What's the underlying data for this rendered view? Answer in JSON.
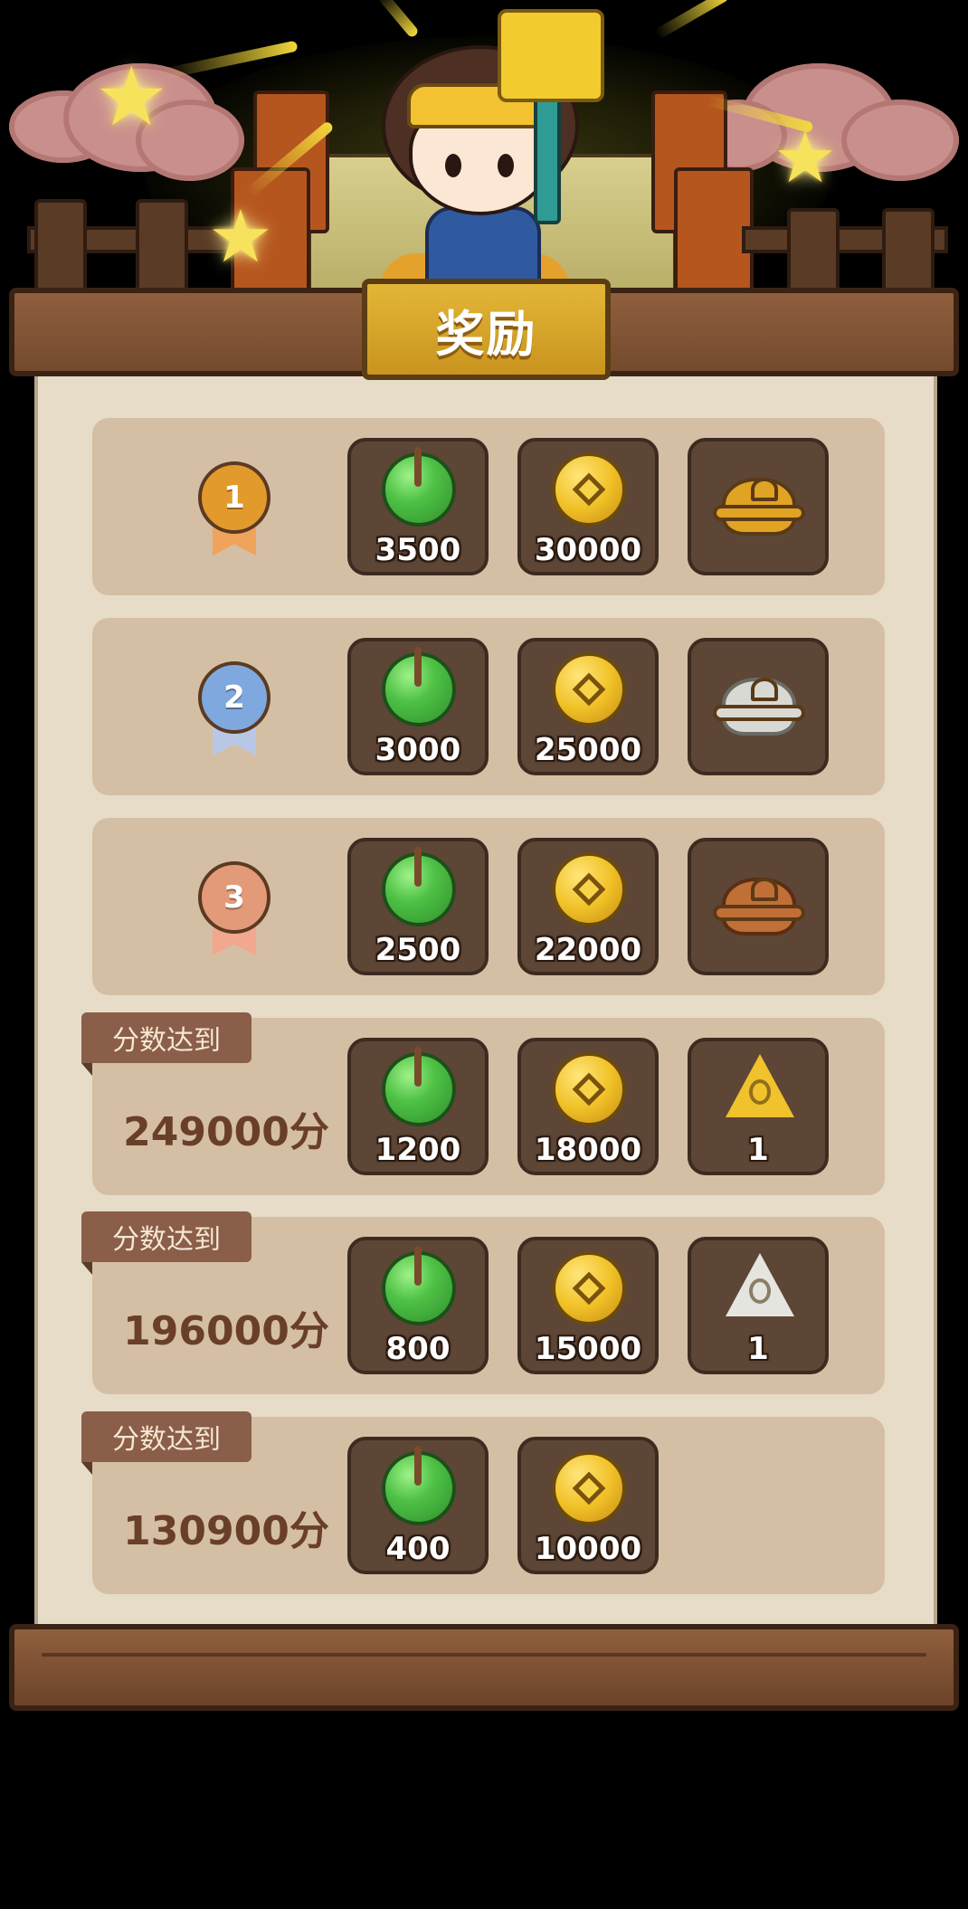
{
  "title": "奖励",
  "rank_rows": [
    {
      "rank": "1",
      "medal_color": "#e39a2c",
      "ribbon_color": "#f0a35a",
      "rewards": [
        {
          "icon": "jade-icon",
          "qty": "3500"
        },
        {
          "icon": "coin-icon",
          "qty": "30000"
        },
        {
          "icon": "gold-censer-icon",
          "qty": ""
        }
      ]
    },
    {
      "rank": "2",
      "medal_color": "#7fa8de",
      "ribbon_color": "#b9c7e6",
      "rewards": [
        {
          "icon": "jade-icon",
          "qty": "3000"
        },
        {
          "icon": "coin-icon",
          "qty": "25000"
        },
        {
          "icon": "silver-censer-icon",
          "qty": ""
        }
      ]
    },
    {
      "rank": "3",
      "medal_color": "#e39a78",
      "ribbon_color": "#f1a88e",
      "rewards": [
        {
          "icon": "jade-icon",
          "qty": "2500"
        },
        {
          "icon": "coin-icon",
          "qty": "22000"
        },
        {
          "icon": "bronze-censer-icon",
          "qty": ""
        }
      ]
    }
  ],
  "score_rows": [
    {
      "tag": "分数达到",
      "score": "249000分",
      "rewards": [
        {
          "icon": "jade-icon",
          "qty": "1200"
        },
        {
          "icon": "coin-icon",
          "qty": "18000"
        },
        {
          "icon": "gold-talisman-icon",
          "qty": "1"
        }
      ]
    },
    {
      "tag": "分数达到",
      "score": "196000分",
      "rewards": [
        {
          "icon": "jade-icon",
          "qty": "800"
        },
        {
          "icon": "coin-icon",
          "qty": "15000"
        },
        {
          "icon": "silver-talisman-icon",
          "qty": "1"
        }
      ]
    },
    {
      "tag": "分数达到",
      "score": "130900分",
      "rewards": [
        {
          "icon": "jade-icon",
          "qty": "400"
        },
        {
          "icon": "coin-icon",
          "qty": "10000"
        }
      ]
    }
  ]
}
